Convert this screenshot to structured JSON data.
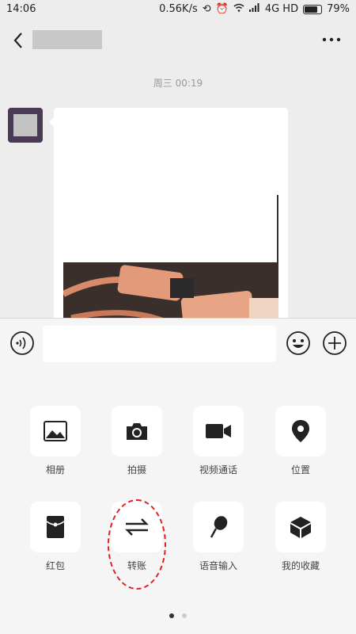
{
  "status_bar": {
    "time": "14:06",
    "network_speed": "0.56K/s",
    "network_type": "4G HD",
    "battery": "79%",
    "battery_level": 0.79
  },
  "chat": {
    "timestamp": "周三 00:19"
  },
  "input_bar": {
    "placeholder": ""
  },
  "panel": {
    "row1": [
      "相册",
      "拍摄",
      "视频通话",
      "位置"
    ],
    "row2": [
      "红包",
      "转账",
      "语音输入",
      "我的收藏"
    ],
    "page_count": 2,
    "active_page": 1
  },
  "colors": {
    "background": "#ededed",
    "panel": "#f5f5f5",
    "annotation": "#e02020"
  }
}
